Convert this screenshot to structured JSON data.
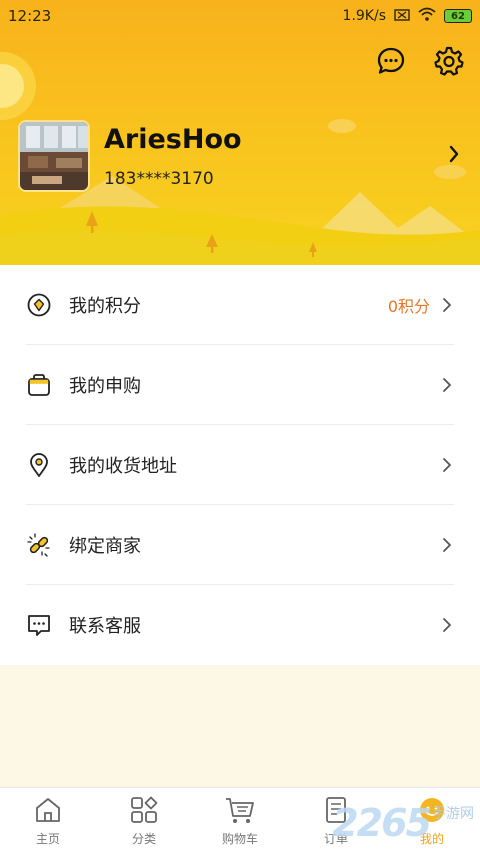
{
  "status_bar": {
    "time": "12:23",
    "speed": "1.9K/s",
    "battery": "62"
  },
  "header": {
    "chat_icon": "chat-bubble-icon",
    "settings_icon": "gear-icon"
  },
  "profile": {
    "username": "AriesHoo",
    "phone": "183****3170"
  },
  "menu": {
    "items": [
      {
        "icon": "points-icon",
        "label": "我的积分",
        "value": "0积分"
      },
      {
        "icon": "bag-icon",
        "label": "我的申购",
        "value": ""
      },
      {
        "icon": "location-pin-icon",
        "label": "我的收货地址",
        "value": ""
      },
      {
        "icon": "link-icon",
        "label": "绑定商家",
        "value": ""
      },
      {
        "icon": "message-icon",
        "label": "联系客服",
        "value": ""
      }
    ]
  },
  "tabs": [
    {
      "icon": "home-icon",
      "label": "主页",
      "active": false
    },
    {
      "icon": "category-icon",
      "label": "分类",
      "active": false
    },
    {
      "icon": "cart-icon",
      "label": "购物车",
      "active": false
    },
    {
      "icon": "order-icon",
      "label": "订单",
      "active": false
    },
    {
      "icon": "profile-icon",
      "label": "我的",
      "active": true
    }
  ],
  "watermark": {
    "number": "2265",
    "text": "手游网"
  },
  "colors": {
    "accent": "#f0a214",
    "header_top": "#f8b21b",
    "header_bottom": "#f7d320",
    "points_value": "#e5772a"
  }
}
